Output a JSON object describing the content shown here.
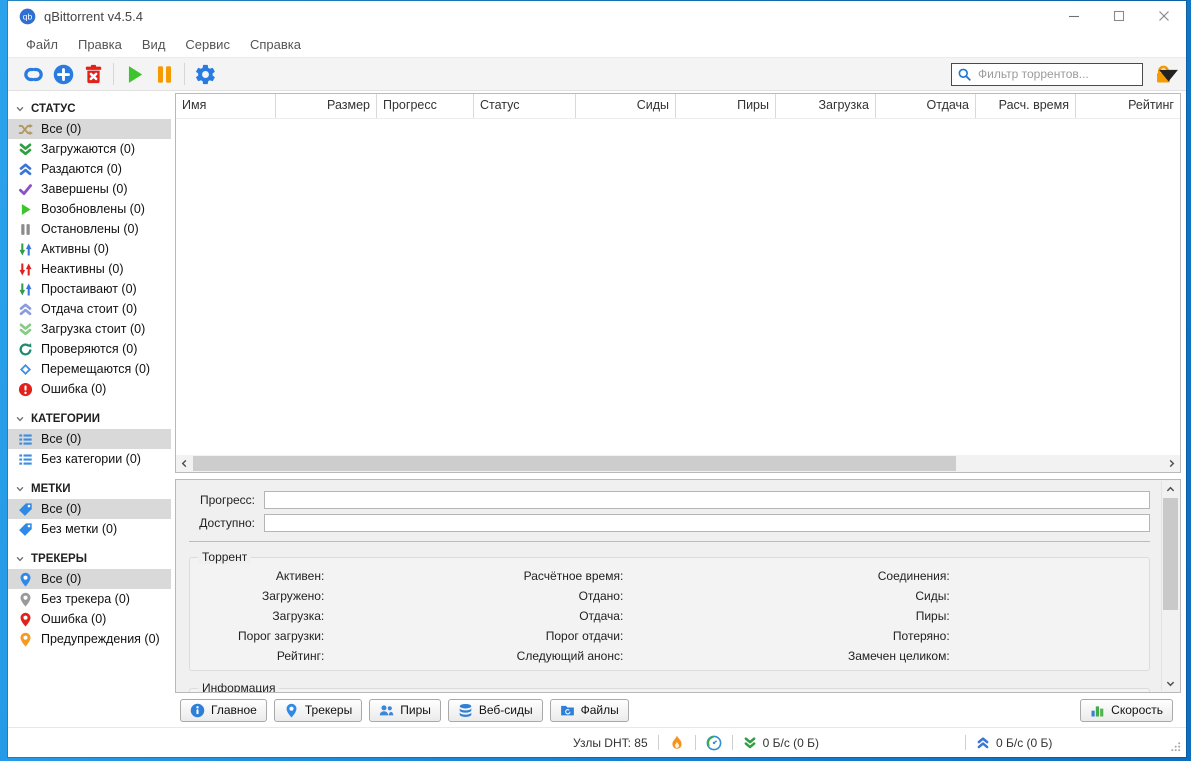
{
  "window": {
    "title": "qBittorrent v4.5.4"
  },
  "menu": {
    "items": [
      "Файл",
      "Правка",
      "Вид",
      "Сервис",
      "Справка"
    ]
  },
  "toolbar": {
    "groups": [
      [
        {
          "name": "add-torrent-link-button",
          "icon": "link",
          "color": "#2a7be0"
        },
        {
          "name": "add-torrent-file-button",
          "icon": "plus-circle",
          "color": "#2a7be0"
        },
        {
          "name": "delete-torrent-button",
          "icon": "trash",
          "color": "#e2211c"
        }
      ],
      [
        {
          "name": "resume-button",
          "icon": "play",
          "color": "#3fc42d"
        },
        {
          "name": "pause-button",
          "icon": "pause",
          "color": "#f59b00"
        }
      ],
      [
        {
          "name": "options-button",
          "icon": "gear",
          "color": "#2a7be0"
        }
      ]
    ],
    "filter": {
      "placeholder": "Фильтр торрентов...",
      "icon": "search",
      "icon_color": "#1d79d4"
    },
    "lock": {
      "icon": "lock",
      "color": "#f59b00"
    }
  },
  "sidebar": {
    "sections": [
      {
        "title": "СТАТУС",
        "items": [
          {
            "label": "Все (0)",
            "icon": "shuffle",
            "color": "#b3975f",
            "selected": true
          },
          {
            "label": "Загружаются (0)",
            "icon": "chevrons-down",
            "color": "#2f9e44"
          },
          {
            "label": "Раздаются (0)",
            "icon": "chevrons-up",
            "color": "#3b76d6"
          },
          {
            "label": "Завершены (0)",
            "icon": "check",
            "color": "#8a52c8"
          },
          {
            "label": "Возобновлены (0)",
            "icon": "play",
            "color": "#3fc42d"
          },
          {
            "label": "Остановлены (0)",
            "icon": "pause",
            "color": "#8c8c8c"
          },
          {
            "label": "Активны (0)",
            "icon": "arrows-active",
            "color": "#2f9e44"
          },
          {
            "label": "Неактивны (0)",
            "icon": "arrows-inactive",
            "color": "#e2211c"
          },
          {
            "label": "Простаивают (0)",
            "icon": "arrows-active",
            "color": "#2f9e44"
          },
          {
            "label": "Отдача стоит (0)",
            "icon": "chevrons-up",
            "color": "#8a9ce0"
          },
          {
            "label": "Загрузка стоит (0)",
            "icon": "chevrons-down",
            "color": "#87cb87"
          },
          {
            "label": "Проверяются (0)",
            "icon": "refresh",
            "color": "#1f8a70"
          },
          {
            "label": "Перемещаются (0)",
            "icon": "diamond",
            "color": "#3c8ee2"
          },
          {
            "label": "Ошибка (0)",
            "icon": "error",
            "color": "#e2211c"
          }
        ]
      },
      {
        "title": "КАТЕГОРИИ",
        "items": [
          {
            "label": "Все (0)",
            "icon": "list",
            "color": "#3c8ee2",
            "selected": true
          },
          {
            "label": "Без категории (0)",
            "icon": "list",
            "color": "#3c8ee2"
          }
        ]
      },
      {
        "title": "МЕТКИ",
        "items": [
          {
            "label": "Все (0)",
            "icon": "tag",
            "color": "#2e8ae6",
            "selected": true
          },
          {
            "label": "Без метки (0)",
            "icon": "tag",
            "color": "#2e8ae6"
          }
        ]
      },
      {
        "title": "ТРЕКЕРЫ",
        "items": [
          {
            "label": "Все (0)",
            "icon": "pin",
            "color": "#2e8ae6",
            "selected": true
          },
          {
            "label": "Без трекера (0)",
            "icon": "pin",
            "color": "#9a9a9a"
          },
          {
            "label": "Ошибка (0)",
            "icon": "pin",
            "color": "#e2211c"
          },
          {
            "label": "Предупреждения (0)",
            "icon": "pin",
            "color": "#f59b1f"
          }
        ]
      }
    ]
  },
  "table": {
    "columns": [
      "Имя",
      "Размер",
      "Прогресс",
      "Статус",
      "Сиды",
      "Пиры",
      "Загрузка",
      "Отдача",
      "Расч. время",
      "Рейтинг"
    ]
  },
  "details": {
    "progress_label": "Прогресс:",
    "available_label": "Доступно:",
    "torrent_group": {
      "title": "Торрент",
      "rows": [
        [
          "Активен:",
          "Расчётное время:",
          "Соединения:"
        ],
        [
          "Загружено:",
          "Отдано:",
          "Сиды:"
        ],
        [
          "Загрузка:",
          "Отдача:",
          "Пиры:"
        ],
        [
          "Порог загрузки:",
          "Порог отдачи:",
          "Потеряно:"
        ],
        [
          "Рейтинг:",
          "Следующий анонс:",
          "Замечен целиком:"
        ]
      ]
    },
    "info_group": {
      "title": "Информация"
    }
  },
  "bottom_tabs": {
    "items": [
      {
        "name": "tab-general",
        "label": "Главное",
        "icon": "info",
        "color": "#2e7fd6"
      },
      {
        "name": "tab-trackers",
        "label": "Трекеры",
        "icon": "pin",
        "color": "#2e8ae6"
      },
      {
        "name": "tab-peers",
        "label": "Пиры",
        "icon": "peers",
        "color": "#3c86e0"
      },
      {
        "name": "tab-webseeds",
        "label": "Веб-сиды",
        "icon": "webseeds",
        "color": "#2e7fd6"
      },
      {
        "name": "tab-files",
        "label": "Файлы",
        "icon": "folder",
        "color": "#2e7fd6"
      }
    ],
    "speed_button": {
      "name": "speed-widget-button",
      "label": "Скорость",
      "icon": "chart"
    }
  },
  "statusbar": {
    "dht_label": "Узлы DHT: 85",
    "download": {
      "icon": "chevrons-down",
      "color": "#2f9e44",
      "text": "0 Б/с (0 Б)"
    },
    "upload": {
      "icon": "chevrons-up",
      "color": "#3b76d6",
      "text": "0 Б/с (0 Б)"
    }
  },
  "colors": {
    "desktop": "#1583d7",
    "accent": "#2a7be0",
    "green": "#2f9e44",
    "orange": "#f59b00",
    "red": "#e2211c",
    "selected_bg": "#d9d9d9"
  }
}
